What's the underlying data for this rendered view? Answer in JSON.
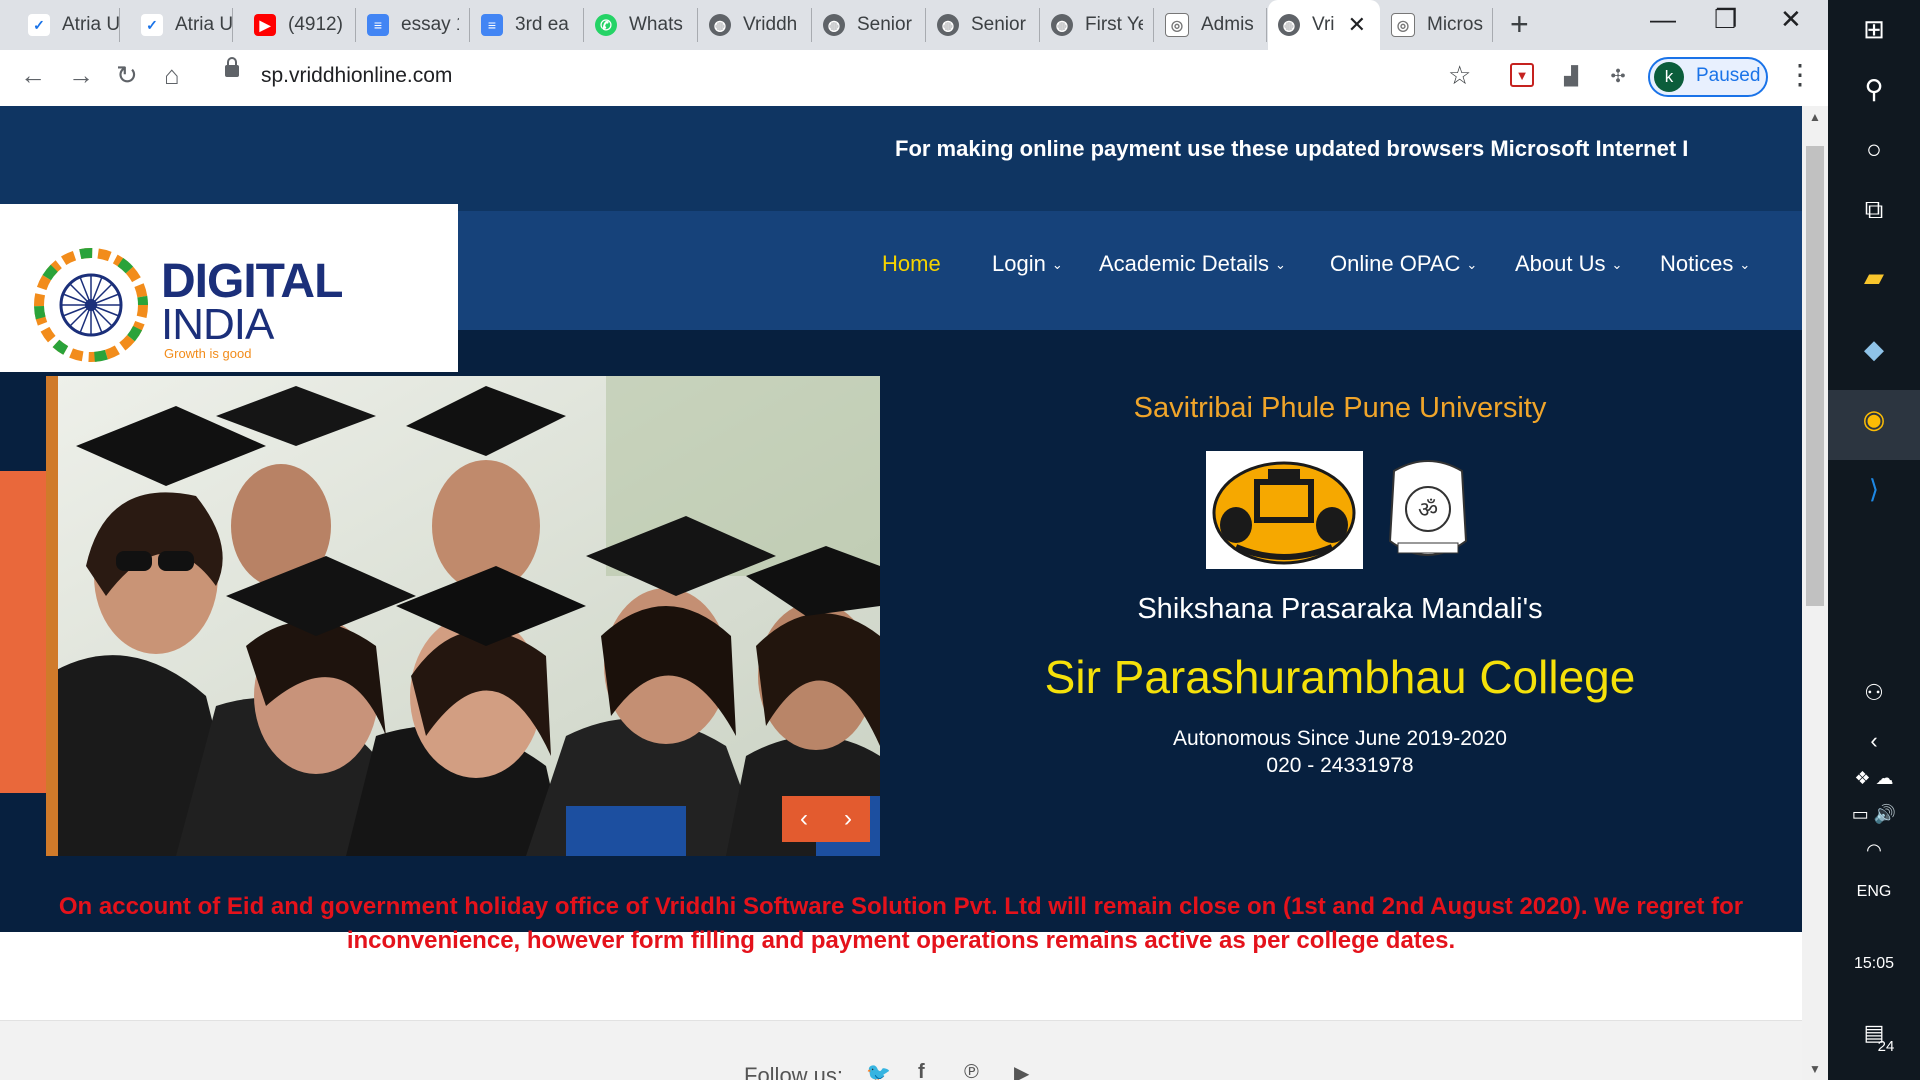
{
  "browser": {
    "tabs": [
      {
        "title": "Atria U",
        "icon": "atria-icon",
        "color": "#1a73e8"
      },
      {
        "title": "Atria U",
        "icon": "atria-icon",
        "color": "#1a73e8"
      },
      {
        "title": "(4912)",
        "icon": "youtube-icon",
        "color": "#ff0000"
      },
      {
        "title": "essay 1",
        "icon": "docs-icon",
        "color": "#4285f4"
      },
      {
        "title": "3rd ea",
        "icon": "docs-icon",
        "color": "#4285f4"
      },
      {
        "title": "Whats",
        "icon": "whatsapp-icon",
        "color": "#25d366"
      },
      {
        "title": "Vriddh",
        "icon": "globe-icon",
        "color": "#5f6368"
      },
      {
        "title": "Senior",
        "icon": "globe-icon",
        "color": "#5f6368"
      },
      {
        "title": "Senior",
        "icon": "globe-icon",
        "color": "#5f6368"
      },
      {
        "title": "First Ye",
        "icon": "globe-icon",
        "color": "#5f6368"
      },
      {
        "title": "Admis",
        "icon": "college-icon",
        "color": "#777777"
      },
      {
        "title": "Vri",
        "icon": "globe-icon",
        "color": "#5f6368",
        "active": true
      },
      {
        "title": "Micros",
        "icon": "college-icon",
        "color": "#777777"
      }
    ],
    "url": "sp.vriddhionline.com",
    "profile_initial": "k",
    "profile_status": "Paused"
  },
  "page": {
    "marquee": "For making online payment use these updated browsers Microsoft Internet I",
    "nav": [
      {
        "label": "Home",
        "active": true,
        "dropdown": false
      },
      {
        "label": "Login",
        "dropdown": true
      },
      {
        "label": "Academic Details",
        "dropdown": true
      },
      {
        "label": "Online OPAC",
        "dropdown": true
      },
      {
        "label": "About Us",
        "dropdown": true
      },
      {
        "label": "Notices",
        "dropdown": true
      }
    ],
    "logo": {
      "line1": "DIGITAL",
      "line2": "INDIA",
      "tagline": "Growth is good"
    },
    "hero": {
      "university": "Savitribai Phule Pune University",
      "society": "Shikshana Prasaraka Mandali's",
      "college": "Sir Parashurambhau College",
      "autonomous": "Autonomous Since June 2019-2020",
      "phone": "020 - 24331978"
    },
    "notice": "On account of Eid and government holiday office of Vriddhi Software Solution Pvt. Ltd will remain close on (1st and 2nd August 2020). We regret for inconvenience, however form filling and payment operations remains active as per college dates.",
    "footer": {
      "follow_label": "Follow us:"
    }
  },
  "taskbar": {
    "language": "ENG",
    "time": "15:05",
    "notifications": "24"
  },
  "colors": {
    "header_blue": "#133a6b",
    "hero_dark": "#07203f",
    "gold": "#f0a52a",
    "yellow": "#f5e10a",
    "notice_red": "#e4121b",
    "accent_orange": "#e35b2f"
  }
}
